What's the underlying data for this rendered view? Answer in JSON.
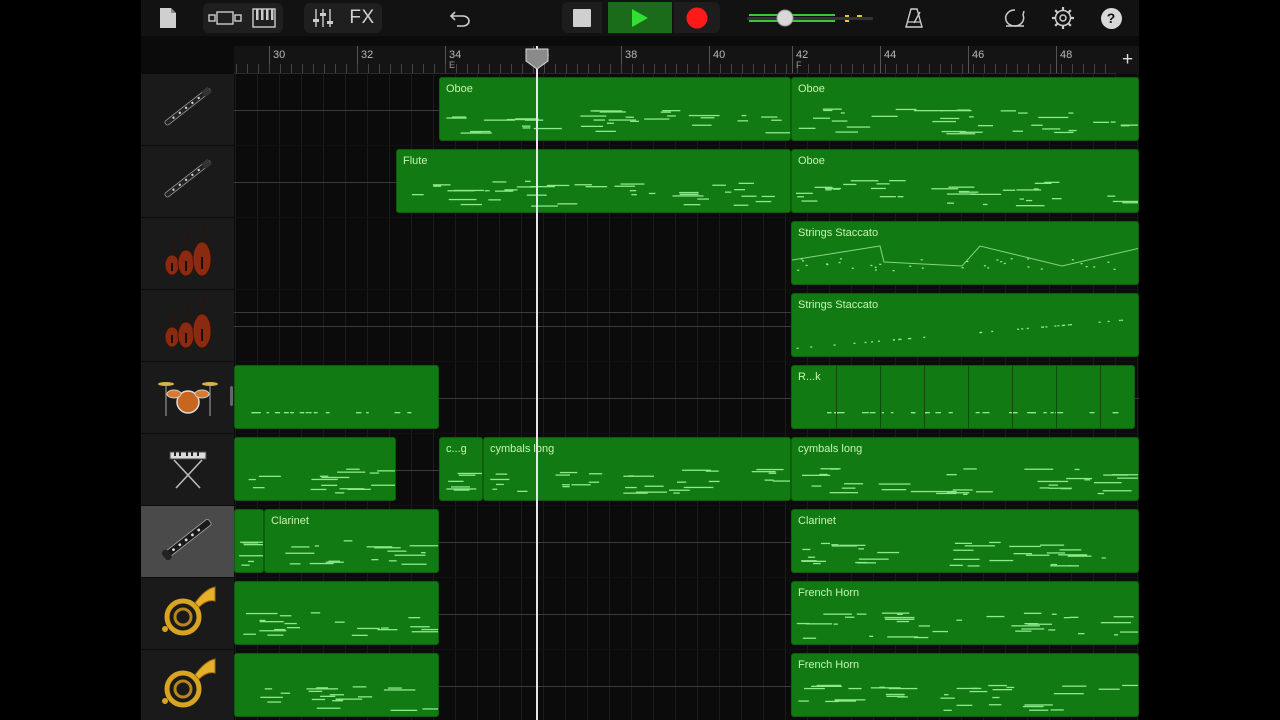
{
  "toolbar": {
    "fx_label": "FX",
    "icons": [
      "document-icon",
      "view-toggle-icon",
      "keyboard-icon",
      "mixer-icon",
      "undo-icon",
      "stop-icon",
      "play-icon",
      "record-icon",
      "master-volume-slider",
      "metronome-icon",
      "loop-icon",
      "settings-icon",
      "help-icon"
    ],
    "help_label": "?",
    "colors": {
      "play": "#2ecc40",
      "record": "#ff1a1a",
      "accent": "#1a7a1a"
    }
  },
  "ruler": {
    "bars": [
      "30",
      "32",
      "34",
      "36",
      "38",
      "40",
      "42",
      "44",
      "46",
      "48"
    ],
    "markers": [
      {
        "bar": "34",
        "label": "E"
      },
      {
        "bar": "42",
        "label": "F"
      }
    ],
    "add_label": "+"
  },
  "tracks": [
    {
      "instrument": "oboe",
      "icon": "oboe-icon",
      "selected": false
    },
    {
      "instrument": "flute",
      "icon": "oboe-icon",
      "selected": false
    },
    {
      "instrument": "strings",
      "icon": "strings-icon",
      "selected": false
    },
    {
      "instrument": "strings",
      "icon": "strings-icon",
      "selected": false
    },
    {
      "instrument": "drums",
      "icon": "drum-kit-icon",
      "selected": false
    },
    {
      "instrument": "keyboard",
      "icon": "keyboard-stand-icon",
      "selected": false
    },
    {
      "instrument": "clarinet",
      "icon": "clarinet-icon",
      "selected": true
    },
    {
      "instrument": "french-horn",
      "icon": "french-horn-icon",
      "selected": false
    },
    {
      "instrument": "french-horn",
      "icon": "french-horn-icon",
      "selected": false
    }
  ],
  "regions": [
    {
      "track": 0,
      "name": "Oboe"
    },
    {
      "track": 0,
      "name": "Oboe"
    },
    {
      "track": 1,
      "name": "Flute"
    },
    {
      "track": 1,
      "name": "Oboe"
    },
    {
      "track": 2,
      "name": "Strings Staccato"
    },
    {
      "track": 3,
      "name": "Strings Staccato"
    },
    {
      "track": 4,
      "name": ""
    },
    {
      "track": 4,
      "name": "R...k"
    },
    {
      "track": 5,
      "name": ""
    },
    {
      "track": 5,
      "name": "c...g"
    },
    {
      "track": 5,
      "name": "cymbals long"
    },
    {
      "track": 5,
      "name": "cymbals long"
    },
    {
      "track": 6,
      "name": ""
    },
    {
      "track": 6,
      "name": "Clarinet"
    },
    {
      "track": 6,
      "name": "Clarinet"
    },
    {
      "track": 7,
      "name": ""
    },
    {
      "track": 7,
      "name": "French Horn"
    },
    {
      "track": 8,
      "name": ""
    },
    {
      "track": 8,
      "name": "French Horn"
    }
  ]
}
